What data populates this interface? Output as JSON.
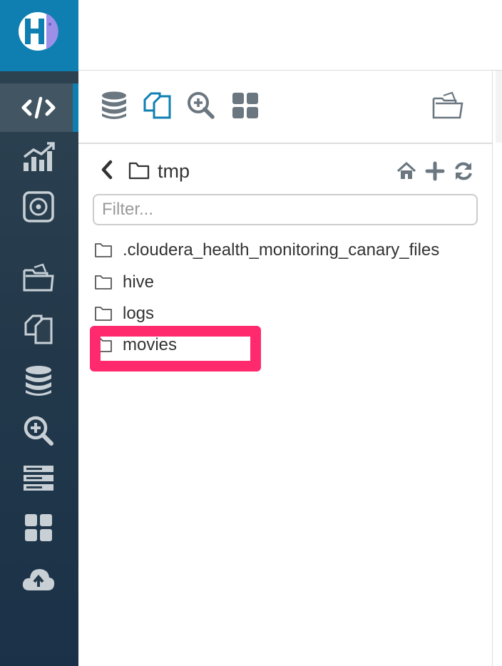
{
  "app": {
    "logo_alt": "Hue logo",
    "brand_color": "#0f7fb2",
    "rail_color": "#263b4c"
  },
  "rail": {
    "items": [
      {
        "name": "editor",
        "icon": "code-icon",
        "active": true
      },
      {
        "name": "dashboard",
        "icon": "chart-icon"
      },
      {
        "name": "scheduler",
        "icon": "target-icon"
      },
      {
        "name": "files",
        "icon": "folder-open-icon"
      },
      {
        "name": "documents",
        "icon": "documents-icon"
      },
      {
        "name": "tables",
        "icon": "database-icon"
      },
      {
        "name": "jobs",
        "icon": "search-plus-icon"
      },
      {
        "name": "hbase",
        "icon": "server-icon"
      },
      {
        "name": "apps",
        "icon": "grid-icon"
      },
      {
        "name": "importer",
        "icon": "cloud-upload-icon"
      }
    ]
  },
  "toolbar": {
    "buttons": [
      {
        "name": "sql-database",
        "icon": "database-icon"
      },
      {
        "name": "hdfs-files",
        "icon": "documents-icon",
        "active": true
      },
      {
        "name": "jobs",
        "icon": "search-plus-icon"
      },
      {
        "name": "apps",
        "icon": "grid-icon"
      }
    ],
    "right_button": {
      "name": "open-file-browser",
      "icon": "folder-open-icon"
    },
    "active_color": "#0f7fb2",
    "inactive_color": "#6b7780"
  },
  "browser": {
    "current_path_label": "tmp",
    "filter_placeholder": "Filter...",
    "filter_value": "",
    "actions": [
      {
        "name": "home",
        "icon": "home-icon"
      },
      {
        "name": "new",
        "icon": "plus-icon"
      },
      {
        "name": "refresh",
        "icon": "refresh-icon"
      }
    ],
    "entries": [
      {
        "name": ".cloudera_health_monitoring_canary_files",
        "type": "folder"
      },
      {
        "name": "hive",
        "type": "folder"
      },
      {
        "name": "logs",
        "type": "folder"
      },
      {
        "name": "movies",
        "type": "folder",
        "highlighted": true
      }
    ],
    "highlight_color": "#ff2a6d"
  }
}
